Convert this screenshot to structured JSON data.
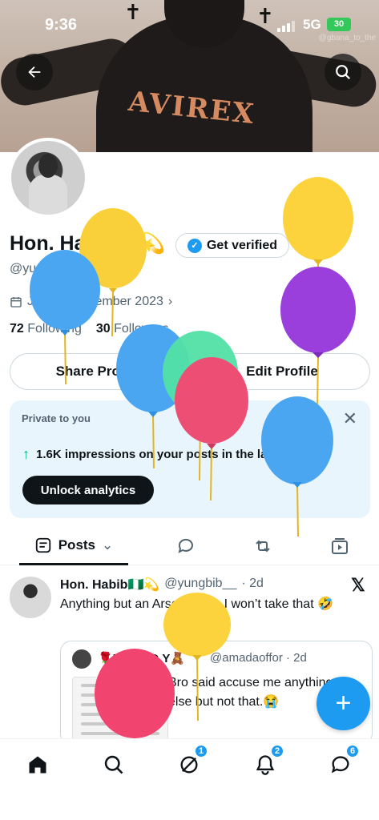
{
  "status_bar": {
    "time": "9:36",
    "network": "5G",
    "battery": "30"
  },
  "banner": {
    "jacket_text": "AVIREX",
    "watermark": "@gbana_to_the"
  },
  "profile": {
    "name": "Hon. Habib🇳🇬💫",
    "verify_label": "Get verified",
    "handle": "@yungbib__",
    "joined": "Joined September 2023",
    "following_count": "72",
    "following_label": "Following",
    "followers_count": "30",
    "followers_label": "Followers",
    "share_label": "Share Profile",
    "edit_label": "Edit Profile"
  },
  "private_card": {
    "label": "Private to you",
    "impressions_text": "1.6K impressions on your posts in the last 7 days",
    "unlock_label": "Unlock analytics"
  },
  "tabs": {
    "posts_label": "Posts"
  },
  "tweet": {
    "name": "Hon. Habib🇳🇬💫",
    "handle": "@yungbib__",
    "time": "· 2d",
    "text": "Anything but an Arsenal fan, I won’t take that 🤣",
    "quote": {
      "name": "🌹M.A.D.D.Y🧸",
      "handle": "@amadaoffor · 2d",
      "text": "Bro said accuse me anything else but not that.😭"
    }
  },
  "nav_badges": {
    "grok": "1",
    "notifications": "2",
    "messages": "6"
  },
  "colors": {
    "accent": "#1d9bf0",
    "text": "#0f1419",
    "muted": "#536471"
  }
}
